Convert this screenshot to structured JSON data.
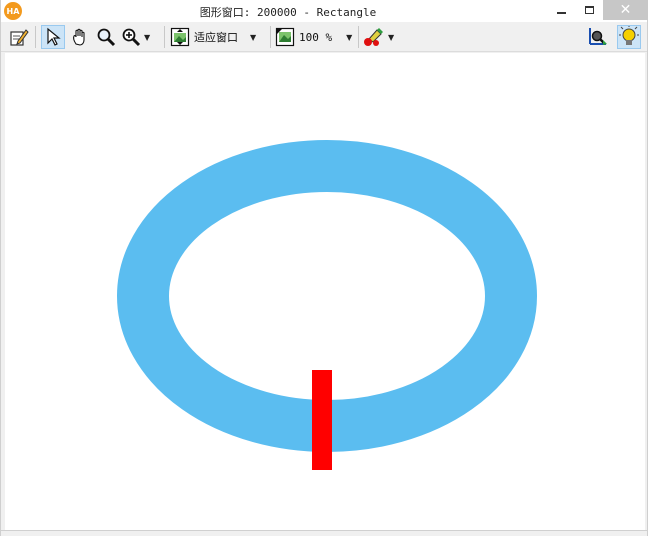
{
  "window": {
    "app_icon_text": "HA",
    "title": "图形窗口: 200000 - Rectangle",
    "minimize_symbol": "",
    "close_symbol": "✕"
  },
  "toolbar": {
    "fit_label": "适应窗口",
    "zoom_label": "100 %",
    "dropdown_arrow": "▼"
  },
  "canvas": {
    "background_color": "#ffffff",
    "ring_color": "#5bbdf0",
    "rectangle_color": "#ff0000"
  }
}
